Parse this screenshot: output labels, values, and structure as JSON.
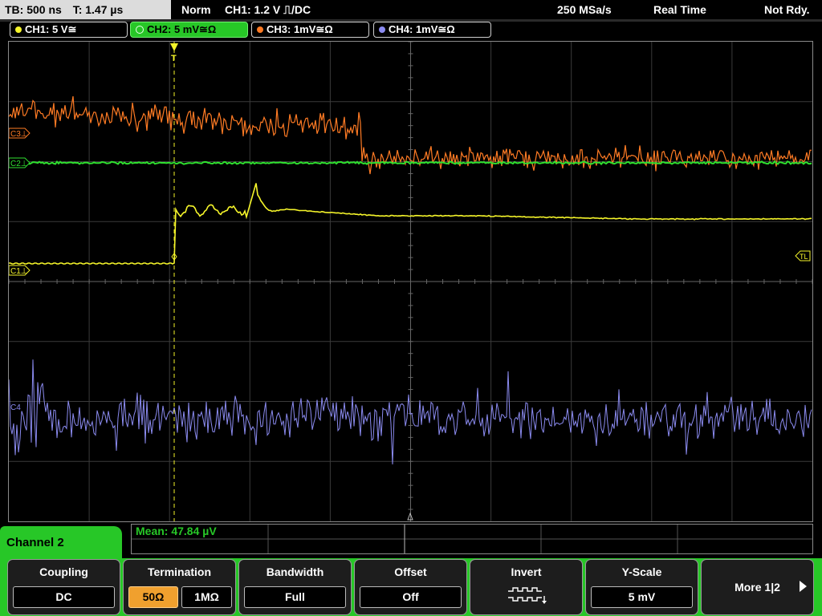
{
  "status_bar": {
    "timebase": "TB: 500 ns",
    "trigger_time": "T: 1.47 µs",
    "trigger_mode": "Norm",
    "trigger_info": "CH1: 1.2 V ⎍/DC",
    "sample_rate": "250 MSa/s",
    "acq_mode": "Real Time",
    "ready_state": "Not Rdy."
  },
  "channels": [
    {
      "label": "CH1: 5 V≅",
      "color": "#f5f52a"
    },
    {
      "label": "CH2: 5 mV≅Ω",
      "color": "#2fe02f"
    },
    {
      "label": "CH3: 1mV≅Ω",
      "color": "#ff7b24"
    },
    {
      "label": "CH4: 1mV≅Ω",
      "color": "#8b8bf0"
    }
  ],
  "markers": {
    "c3": "C3⊥",
    "c2": "C2⊥",
    "c1": "C1⊥",
    "c4": "C4",
    "tl": "TL",
    "trigger": "T"
  },
  "measurement": {
    "text": "Mean: 47.84 µV"
  },
  "menu": {
    "title": "Channel 2",
    "coupling": {
      "title": "Coupling",
      "value": "DC"
    },
    "termination": {
      "title": "Termination",
      "opt1": "50Ω",
      "opt2": "1MΩ"
    },
    "bandwidth": {
      "title": "Bandwidth",
      "value": "Full"
    },
    "offset": {
      "title": "Offset",
      "value": "Off"
    },
    "invert": {
      "title": "Invert"
    },
    "yscale": {
      "title": "Y-Scale",
      "value": "5 mV"
    },
    "more": {
      "title": "More 1|2"
    }
  },
  "colors": {
    "menu_accent": "#27c727",
    "selected_option": "#f0a02e",
    "trigger_marker": "#f5f52a"
  }
}
